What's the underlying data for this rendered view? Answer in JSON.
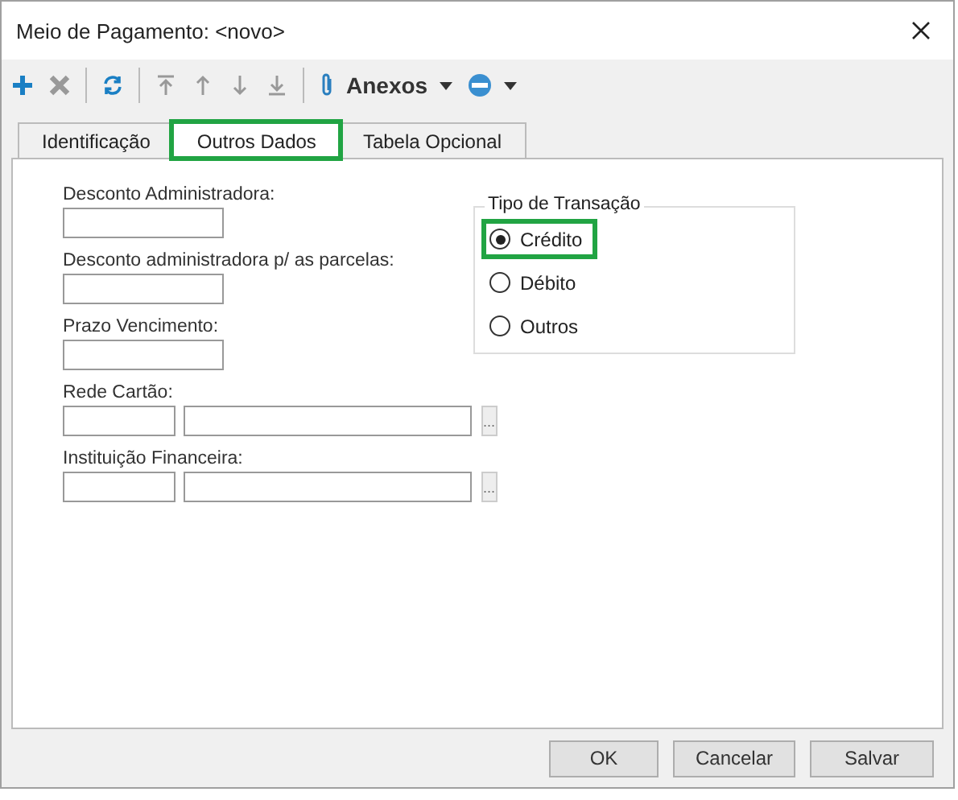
{
  "window": {
    "title": "Meio de Pagamento: <novo>"
  },
  "toolbar": {
    "buttons": [
      {
        "disabled": false
      },
      {
        "disabled": true
      },
      {
        "disabled": false
      },
      {
        "disabled": true
      },
      {
        "disabled": true
      },
      {
        "disabled": true
      },
      {
        "disabled": true
      }
    ],
    "attachments_label": "Anexos"
  },
  "tabs": [
    {
      "label": "Identificação",
      "selected": false,
      "highlighted": false
    },
    {
      "label": "Outros Dados",
      "selected": true,
      "highlighted": true
    },
    {
      "label": "Tabela Opcional",
      "selected": false,
      "highlighted": false
    }
  ],
  "fields": [
    {
      "label": "Desconto Administradora:",
      "kind": "text"
    },
    {
      "label": "Desconto administradora p/ as parcelas:",
      "kind": "text"
    },
    {
      "label": "Prazo Vencimento:",
      "kind": "text"
    },
    {
      "label": "Rede Cartão:",
      "kind": "lookup",
      "button": "..."
    },
    {
      "label": "Instituição Financeira:",
      "kind": "lookup",
      "button": "..."
    }
  ],
  "transaction_type": {
    "title": "Tipo de Transação",
    "options": [
      {
        "label": "Crédito",
        "selected": true,
        "highlighted": true
      },
      {
        "label": "Débito",
        "selected": false,
        "highlighted": false
      },
      {
        "label": "Outros",
        "selected": false,
        "highlighted": false
      }
    ]
  },
  "buttons": [
    "OK",
    "Cancelar",
    "Salvar"
  ]
}
